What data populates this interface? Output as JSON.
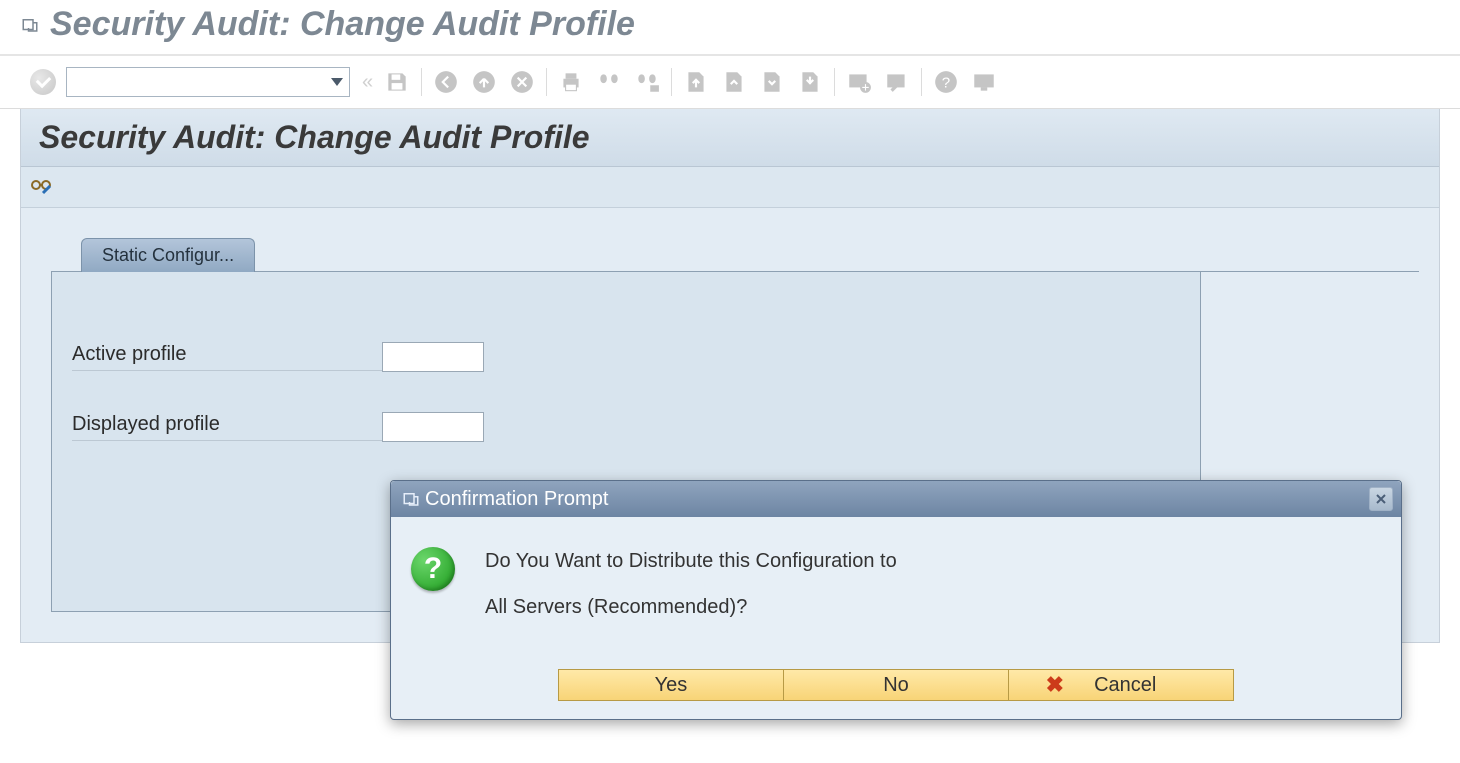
{
  "window": {
    "title": "Security Audit: Change Audit Profile"
  },
  "toolbar": {
    "command_value": ""
  },
  "page": {
    "title": "Security Audit: Change Audit Profile"
  },
  "tabs": {
    "static_config_label": "Static Configur..."
  },
  "fields": {
    "active_profile_label": "Active profile",
    "active_profile_value": "",
    "displayed_profile_label": "Displayed profile",
    "displayed_profile_value": ""
  },
  "dialog": {
    "title": "Confirmation Prompt",
    "line1": "Do You Want to Distribute this Configuration to",
    "line2": "All Servers (Recommended)?",
    "yes": "Yes",
    "no": "No",
    "cancel": "Cancel"
  }
}
